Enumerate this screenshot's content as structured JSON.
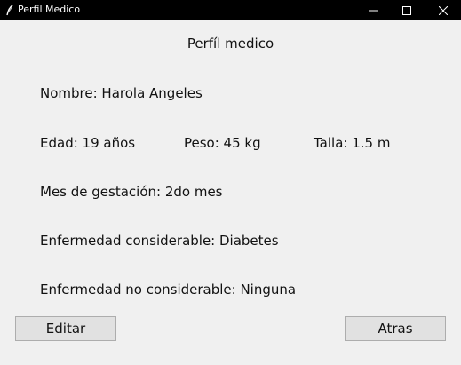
{
  "window": {
    "title": "Perfil Medico"
  },
  "page": {
    "title": "Perfíl medico"
  },
  "profile": {
    "nombre": "Nombre: Harola Angeles",
    "edad": "Edad: 19 años",
    "peso": "Peso: 45 kg",
    "talla": "Talla: 1.5 m",
    "mes_gestacion": "Mes de gestación: 2do mes",
    "enfermedad_considerable": "Enfermedad considerable: Diabetes",
    "enfermedad_no_considerable": "Enfermedad no considerable: Ninguna"
  },
  "buttons": {
    "editar": "Editar",
    "atras": "Atras"
  },
  "icons": {
    "app": "feather-icon",
    "minimize": "minimize-icon",
    "maximize": "maximize-icon",
    "close": "close-icon"
  }
}
